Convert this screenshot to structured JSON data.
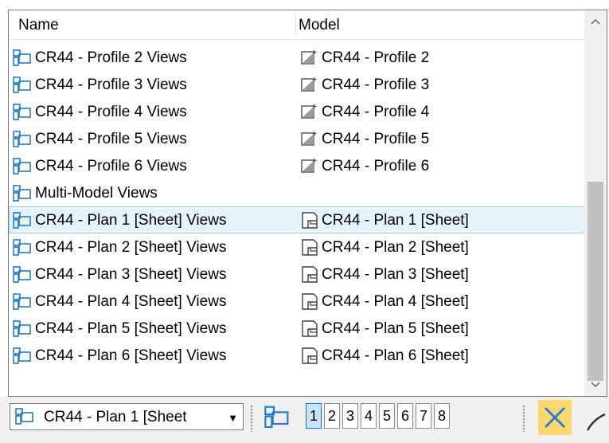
{
  "header": {
    "name_label": "Name",
    "model_label": "Model"
  },
  "rows": [
    {
      "name": "CR44 - Profile 2 Views",
      "model": "CR44 - Profile 2",
      "model_icon": "profile-model-icon"
    },
    {
      "name": "CR44 - Profile 3 Views",
      "model": "CR44 - Profile 3",
      "model_icon": "profile-model-icon"
    },
    {
      "name": "CR44 - Profile 4 Views",
      "model": "CR44 - Profile 4",
      "model_icon": "profile-model-icon"
    },
    {
      "name": "CR44 - Profile 5 Views",
      "model": "CR44 - Profile 5",
      "model_icon": "profile-model-icon"
    },
    {
      "name": "CR44 - Profile 6 Views",
      "model": "CR44 - Profile 6",
      "model_icon": "profile-model-icon"
    },
    {
      "name": "Multi-Model Views",
      "model": "",
      "model_icon": ""
    },
    {
      "name": "CR44 - Plan 1 [Sheet] Views",
      "model": "CR44 - Plan 1 [Sheet]",
      "model_icon": "sheet-model-icon",
      "selected": true
    },
    {
      "name": "CR44 - Plan 2 [Sheet] Views",
      "model": "CR44 - Plan 2 [Sheet]",
      "model_icon": "sheet-model-icon"
    },
    {
      "name": "CR44 - Plan 3 [Sheet] Views",
      "model": "CR44 - Plan 3 [Sheet]",
      "model_icon": "sheet-model-icon"
    },
    {
      "name": "CR44 - Plan 4 [Sheet] Views",
      "model": "CR44 - Plan 4 [Sheet]",
      "model_icon": "sheet-model-icon"
    },
    {
      "name": "CR44 - Plan 5 [Sheet] Views",
      "model": "CR44 - Plan 5 [Sheet]",
      "model_icon": "sheet-model-icon"
    },
    {
      "name": "CR44 - Plan 6 [Sheet] Views",
      "model": "CR44 - Plan 6 [Sheet]",
      "model_icon": "sheet-model-icon"
    }
  ],
  "toolbar": {
    "combo_value": "CR44 - Plan 1 [Sheet",
    "pages": [
      "1",
      "2",
      "3",
      "4",
      "5",
      "6",
      "7",
      "8"
    ],
    "active_page": "1"
  },
  "colors": {
    "accent_blue": "#0078d7",
    "selection_bg": "#e5f3fb",
    "selection_border": "#99d1ef",
    "close_bg": "#ffd76f"
  }
}
